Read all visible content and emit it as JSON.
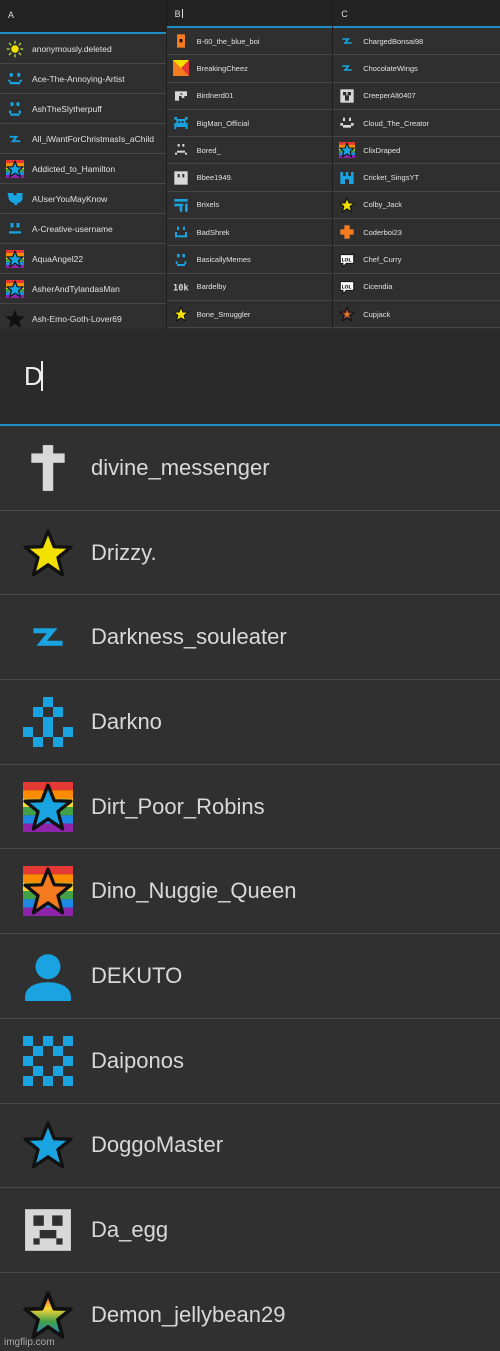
{
  "columns": [
    {
      "header": "A",
      "rows": [
        {
          "name": "anonymously.deleted",
          "icon": "sun-icon"
        },
        {
          "name": "Ace-The-Annoying-Artist",
          "icon": "smile-face-icon"
        },
        {
          "name": "AshTheSlytherpuff",
          "icon": "face-icon"
        },
        {
          "name": "All_iWantForChristmasIs_aChild",
          "icon": "lightning-icon"
        },
        {
          "name": "Addicted_to_Hamilton",
          "icon": "rainbow-star-icon"
        },
        {
          "name": "AUserYouMayKnow",
          "icon": "heart-icon"
        },
        {
          "name": "A-Creative-username",
          "icon": "eyes-face-icon"
        },
        {
          "name": "AquaAngel22",
          "icon": "rainbow-star-icon"
        },
        {
          "name": "AsherAndTylandasMan",
          "icon": "rainbow-star-icon"
        },
        {
          "name": "Ash-Emo-Goth-Lover69",
          "icon": "black-star-icon"
        }
      ]
    },
    {
      "header": "B",
      "rows": [
        {
          "name": "B-60_the_blue_boi",
          "icon": "orange-door-icon"
        },
        {
          "name": "BreakingCheez",
          "icon": "checker-icon"
        },
        {
          "name": "Birdnerd01",
          "icon": "bird-icon"
        },
        {
          "name": "BigMan_Official",
          "icon": "invader-icon"
        },
        {
          "name": "Bored_",
          "icon": "sad-face-icon"
        },
        {
          "name": "Bbee1949.",
          "icon": "block-face-icon"
        },
        {
          "name": "Brixels",
          "icon": "brick-icon"
        },
        {
          "name": "BadShrek",
          "icon": "grin-face-icon"
        },
        {
          "name": "BasicallyMemes",
          "icon": "face-icon"
        },
        {
          "name": "Bardelby",
          "icon": "10k-icon"
        },
        {
          "name": "Bone_Smuggler",
          "icon": "yellow-star-icon"
        }
      ]
    },
    {
      "header": "C",
      "rows": [
        {
          "name": "ChargedBonsai98",
          "icon": "lightning-icon"
        },
        {
          "name": "ChocolateWings",
          "icon": "lightning-icon"
        },
        {
          "name": "CreeperAlt0407",
          "icon": "creeper-icon"
        },
        {
          "name": "Cloud_The_Creator",
          "icon": "cloud-face-icon"
        },
        {
          "name": "ClixDraped",
          "icon": "rainbow-star-icon"
        },
        {
          "name": "Cricket_SingsYT",
          "icon": "castle-icon"
        },
        {
          "name": "Colby_Jack",
          "icon": "yellow-star-icon"
        },
        {
          "name": "Coderboi23",
          "icon": "orange-cross-icon"
        },
        {
          "name": "Chef_Curry",
          "icon": "lol-icon"
        },
        {
          "name": "Cicendia",
          "icon": "lol-icon"
        },
        {
          "name": "Cupjack",
          "icon": "dark-star-icon"
        }
      ]
    }
  ],
  "search": {
    "value": "D"
  },
  "results": [
    {
      "name": "divine_messenger",
      "icon": "cross-icon"
    },
    {
      "name": "Drizzy.",
      "icon": "yellow-star-icon"
    },
    {
      "name": "Darkness_souleater",
      "icon": "lightning-icon"
    },
    {
      "name": "Darkno",
      "icon": "pyramid-icon"
    },
    {
      "name": "Dirt_Poor_Robins",
      "icon": "rainbow-blue-star-icon"
    },
    {
      "name": "Dino_Nuggie_Queen",
      "icon": "rainbow-orange-star-icon"
    },
    {
      "name": "DEKUTO",
      "icon": "person-icon"
    },
    {
      "name": "Daiponos",
      "icon": "diamond-ring-icon"
    },
    {
      "name": "DoggoMaster",
      "icon": "blue-star-icon"
    },
    {
      "name": "Da_egg",
      "icon": "skull-icon"
    },
    {
      "name": "Demon_jellybean29",
      "icon": "rainbow-dark-star-icon"
    }
  ],
  "watermark": "imgflip.com",
  "colors": {
    "accent": "#1f8fc6",
    "blue": "#19a3e0",
    "yellow": "#f2e100",
    "orange": "#f47b20"
  }
}
